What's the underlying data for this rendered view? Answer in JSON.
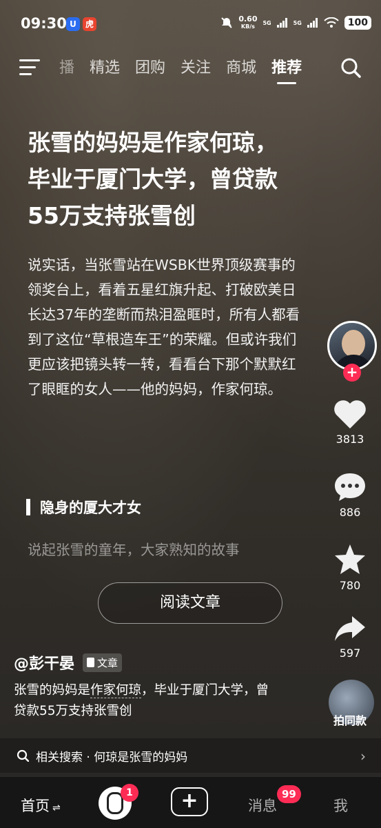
{
  "status_bar": {
    "time": "09:30",
    "speed_value": "0.60",
    "speed_unit": "KB/s",
    "network1": "5G",
    "network2": "5G",
    "battery": "100"
  },
  "top_nav": {
    "tabs": [
      {
        "label": "播",
        "state": "partial"
      },
      {
        "label": "精选"
      },
      {
        "label": "团购"
      },
      {
        "label": "关注"
      },
      {
        "label": "商城"
      },
      {
        "label": "推荐",
        "state": "active"
      }
    ]
  },
  "article": {
    "headline": "张雪的妈妈是作家何琼，毕业于厦门大学，曾贷款55万支持张雪创",
    "body": "说实话，当张雪站在WSBK世界顶级赛事的领奖台上，看着五星红旗升起、打破欧美日长达37年的垄断而热泪盈眶时，所有人都看到了这位“草根造车王”的荣耀。但或许我们更应该把镜头转一转，看看台下那个默默红了眼眶的女人——他的妈妈，作家何琼。",
    "subhead": "隐身的厦大才女",
    "faded_line": "说起张雪的童年，大家熟知的故事",
    "read_button": "阅读文章"
  },
  "rail": {
    "follow": "+",
    "like_count": "3813",
    "comment_count": "886",
    "favorite_count": "780",
    "share_count": "597",
    "same_style_label": "拍同款"
  },
  "author": {
    "handle": "@彭干晏",
    "badge": "文章"
  },
  "caption": {
    "prefix": "张雪的妈妈是",
    "highlight": "作家何琼",
    "suffix": "，毕业于厦门大学，曾贷款55万支持张雪创"
  },
  "related": {
    "text": "相关搜索 · 何琼是张雪的妈妈"
  },
  "bottom_nav": {
    "home": "首页",
    "home_badge": "1",
    "add": "+",
    "messages": "消息",
    "messages_badge": "99",
    "me": "我"
  },
  "colors": {
    "accent": "#fe2c55"
  }
}
